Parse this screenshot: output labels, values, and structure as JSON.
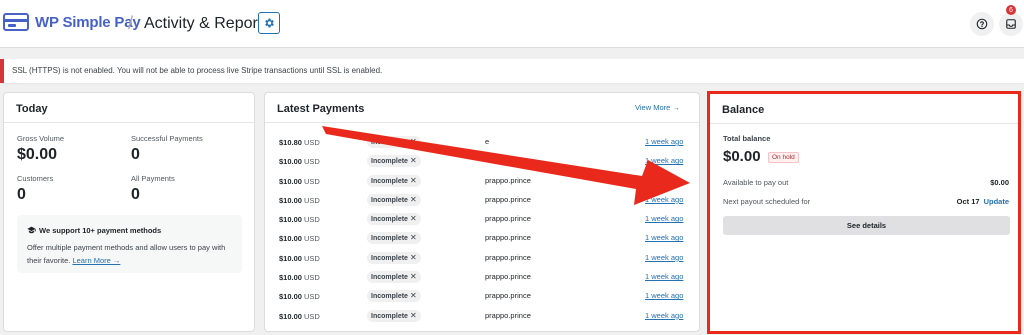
{
  "header": {
    "logo_text": "WP Simple Pay",
    "separator": "/",
    "page_title": "Activity & Reports",
    "notification_count": "6"
  },
  "notice": {
    "text": "SSL (HTTPS) is not enabled. You will not be able to process live Stripe transactions until SSL is enabled."
  },
  "today": {
    "title": "Today",
    "stats": [
      {
        "label": "Gross Volume",
        "value": "$0.00"
      },
      {
        "label": "Successful Payments",
        "value": "0"
      },
      {
        "label": "Customers",
        "value": "0"
      },
      {
        "label": "All Payments",
        "value": "0"
      }
    ],
    "promo": {
      "title": "We support 10+ payment methods",
      "text": "Offer multiple payment methods and allow users to pay with their favorite.",
      "link": "Learn More →"
    }
  },
  "latest_payments": {
    "title": "Latest Payments",
    "view_more": "View More →",
    "rows": [
      {
        "amount": "$10.80",
        "currency": "USD",
        "status": "Incomplete",
        "email": "e",
        "time": "1 week ago"
      },
      {
        "amount": "$10.00",
        "currency": "USD",
        "status": "Incomplete",
        "email": "",
        "time": "1 week ago"
      },
      {
        "amount": "$10.00",
        "currency": "USD",
        "status": "Incomplete",
        "email": "prappo.prince",
        "time": "1 week ago"
      },
      {
        "amount": "$10.00",
        "currency": "USD",
        "status": "Incomplete",
        "email": "prappo.prince",
        "time": "1 week ago"
      },
      {
        "amount": "$10.00",
        "currency": "USD",
        "status": "Incomplete",
        "email": "prappo.prince",
        "time": "1 week ago"
      },
      {
        "amount": "$10.00",
        "currency": "USD",
        "status": "Incomplete",
        "email": "prappo.prince",
        "time": "1 week ago"
      },
      {
        "amount": "$10.00",
        "currency": "USD",
        "status": "Incomplete",
        "email": "prappo.prince",
        "time": "1 week ago"
      },
      {
        "amount": "$10.00",
        "currency": "USD",
        "status": "Incomplete",
        "email": "prappo.prince",
        "time": "1 week ago"
      },
      {
        "amount": "$10.00",
        "currency": "USD",
        "status": "Incomplete",
        "email": "prappo.prince",
        "time": "1 week ago"
      },
      {
        "amount": "$10.00",
        "currency": "USD",
        "status": "Incomplete",
        "email": "prappo.prince",
        "time": "1 week ago"
      }
    ]
  },
  "balance": {
    "title": "Balance",
    "total_label": "Total balance",
    "total_value": "$0.00",
    "status_badge": "On hold",
    "available_label": "Available to pay out",
    "available_value": "$0.00",
    "payout_label": "Next payout scheduled for",
    "payout_date": "Oct 17",
    "update_link": "Update",
    "details_button": "See details"
  },
  "colors": {
    "brand": "#4762c7",
    "link": "#2271b1",
    "notice_border": "#d63638",
    "annotation": "#e8291c"
  },
  "icons": {
    "settings": "gear-icon",
    "help": "help-icon",
    "inbox": "inbox-icon",
    "promo": "graduation-cap-icon",
    "remove": "close-icon"
  }
}
